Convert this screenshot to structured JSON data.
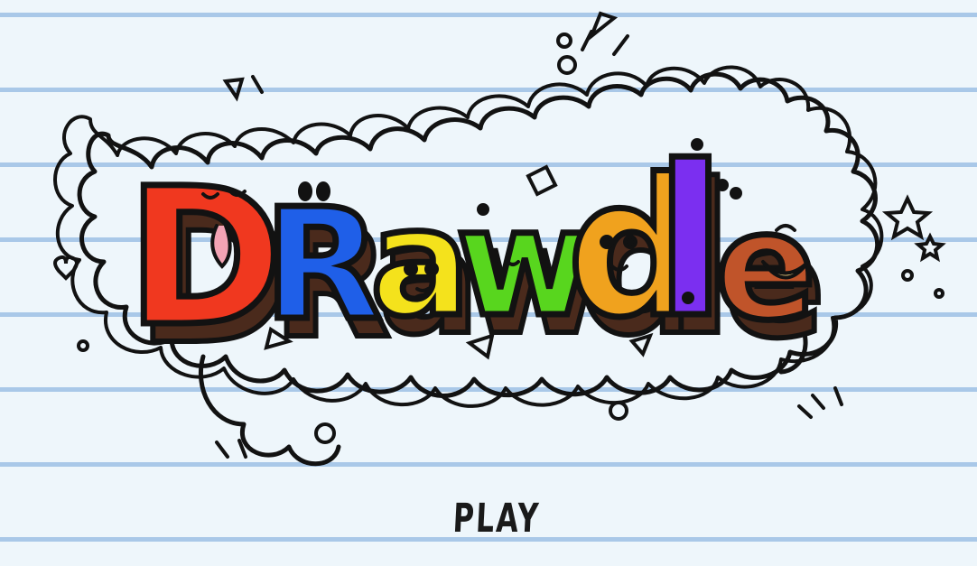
{
  "game": {
    "logo_text": "Drawdle",
    "letters": [
      "D",
      "R",
      "a",
      "w",
      "d",
      "l",
      "e"
    ],
    "letter_colors": [
      "#f0381f",
      "#1f5fe8",
      "#f4e21c",
      "#58d61e",
      "#f0a21e",
      "#7b2ff0",
      "#c0542a"
    ],
    "outline_color": "#121212",
    "shadow_color": "#4a2a1c",
    "paper_color": "#eef6fb",
    "rule_line_color": "#a9c8e8"
  },
  "menu": {
    "play_label": "PLAY"
  }
}
